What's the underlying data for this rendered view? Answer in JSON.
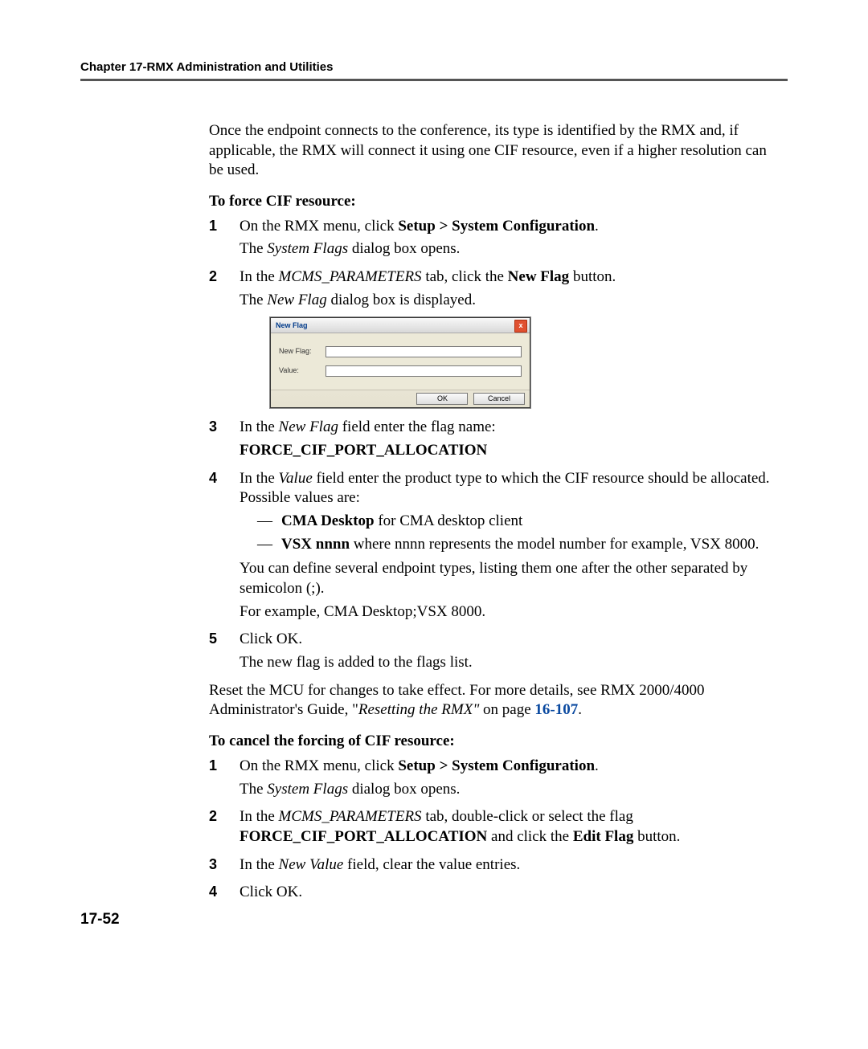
{
  "header": "Chapter 17-RMX Administration and Utilities",
  "intro": "Once the endpoint connects to the conference, its type is identified by the RMX and, if applicable, the RMX will connect it using one CIF resource, even if a higher resolution can be used.",
  "force_head": "To force CIF resource:",
  "force_steps": {
    "s1_a": "On the RMX menu, click ",
    "s1_bold": "Setup > System Configuration",
    "s1_c": ".",
    "s1_sub_a": "The ",
    "s1_sub_i": "System Flags",
    "s1_sub_c": " dialog box opens.",
    "s2_a": "In the ",
    "s2_i": "MCMS_PARAMETERS",
    "s2_b": " tab, click the ",
    "s2_bold": "New Flag",
    "s2_c": " button.",
    "s2_sub_a": "The ",
    "s2_sub_i": "New Flag",
    "s2_sub_c": " dialog box is displayed.",
    "s3_a": "In the ",
    "s3_i": "New Flag",
    "s3_b": " field enter the flag name:",
    "s3_flag": "FORCE_CIF_PORT_ALLOCATION",
    "s4_a": "In the ",
    "s4_i": "Value",
    "s4_b": " field enter the product type to which the CIF resource should be allocated. Possible values are:",
    "s4_d1_bold": "CMA Desktop",
    "s4_d1_rest": " for CMA desktop client",
    "s4_d2_bold": "VSX nnnn",
    "s4_d2_rest": " where nnnn represents the model number for example, VSX 8000.",
    "s4_p1": "You can define several endpoint types, listing them one after the other separated by semicolon (;).",
    "s4_p2": "For example, CMA Desktop;VSX 8000.",
    "s5_a": "Click OK.",
    "s5_sub": "The new flag is added to the flags list."
  },
  "reset_a": "Reset the MCU for changes to take effect. For more details, see RMX 2000/4000 Administrator's Guide, \"",
  "reset_i": "Resetting the RMX\"",
  "reset_b": " on page ",
  "reset_link": "16-107",
  "reset_c": ".",
  "cancel_head": "To cancel the forcing of CIF resource:",
  "cancel_steps": {
    "s1_a": "On the RMX menu, click ",
    "s1_bold": "Setup > System Configuration",
    "s1_c": ".",
    "s1_sub_a": "The ",
    "s1_sub_i": "System Flags",
    "s1_sub_c": " dialog box opens.",
    "s2_a": "In the ",
    "s2_i": "MCMS_PARAMETERS",
    "s2_b": " tab, double-click or select the flag ",
    "s2_flag": "FORCE_CIF_PORT_ALLOCATION",
    "s2_c": " and click the ",
    "s2_bold": "Edit Flag",
    "s2_d": " button.",
    "s3_a": "In the ",
    "s3_i": "New Value",
    "s3_b": " field, clear the value entries.",
    "s4": "Click OK."
  },
  "dialog": {
    "title": "New Flag",
    "close": "x",
    "label_flag": "New Flag:",
    "label_value": "Value:",
    "ok": "OK",
    "cancel": "Cancel"
  },
  "page_number": "17-52",
  "nums": {
    "n1": "1",
    "n2": "2",
    "n3": "3",
    "n4": "4",
    "n5": "5"
  }
}
